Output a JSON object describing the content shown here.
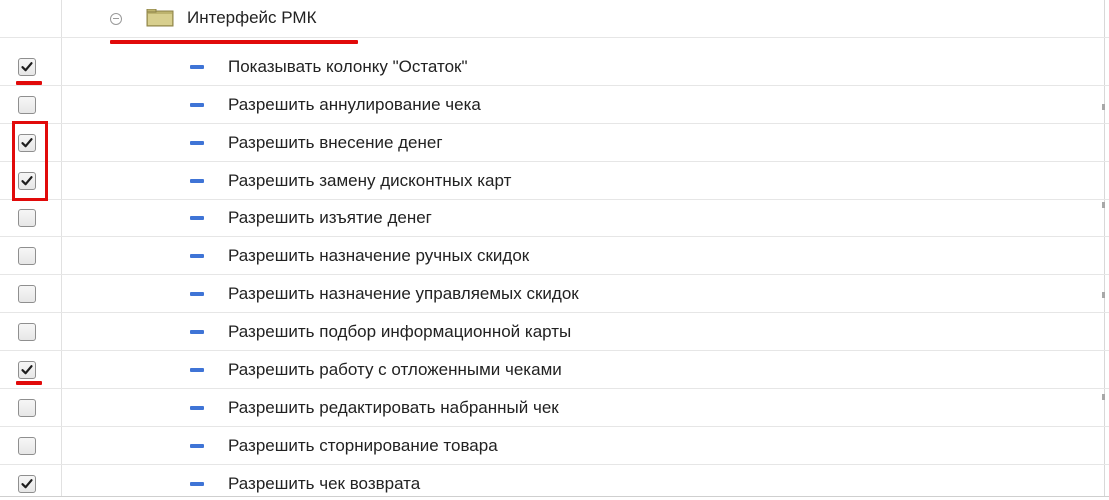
{
  "tree": {
    "group": {
      "label": "Интерфейс РМК",
      "expanded": true,
      "icon": "folder-icon"
    },
    "items": [
      {
        "label": "Показывать колонку \"Остаток\"",
        "checked": true
      },
      {
        "label": "Разрешить аннулирование чека",
        "checked": false
      },
      {
        "label": "Разрешить внесение денег",
        "checked": true
      },
      {
        "label": "Разрешить замену дисконтных карт",
        "checked": true
      },
      {
        "label": "Разрешить изъятие денег",
        "checked": false
      },
      {
        "label": "Разрешить назначение ручных скидок",
        "checked": false
      },
      {
        "label": "Разрешить назначение управляемых скидок",
        "checked": false
      },
      {
        "label": "Разрешить подбор информационной карты",
        "checked": false
      },
      {
        "label": "Разрешить работу с отложенными чеками",
        "checked": true
      },
      {
        "label": "Разрешить редактировать набранный чек",
        "checked": false
      },
      {
        "label": "Разрешить сторнирование товара",
        "checked": false
      },
      {
        "label": "Разрешить чек возврата",
        "checked": true
      }
    ]
  },
  "colors": {
    "annotation_red": "#e10a0a",
    "item_dash_blue": "#3f74d6",
    "folder_olive": "#b7ae6a"
  }
}
